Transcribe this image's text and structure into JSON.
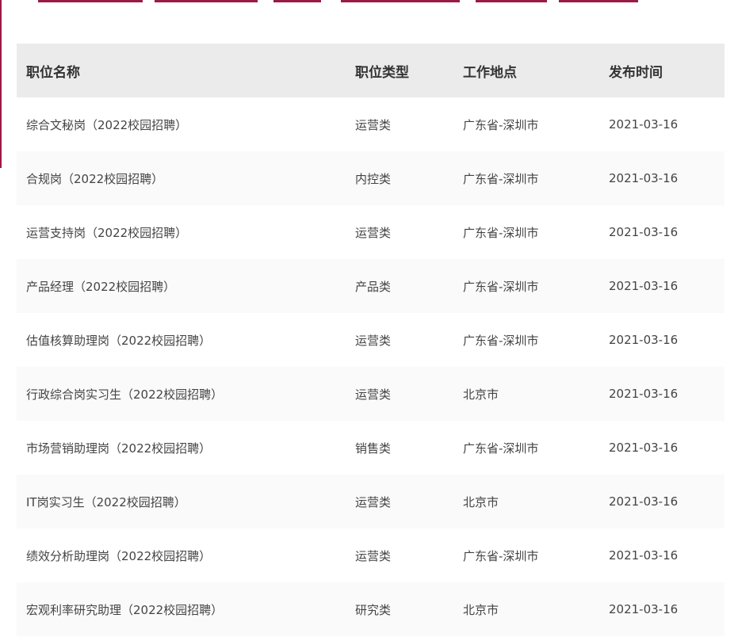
{
  "colors": {
    "accent": "#9a1b47",
    "header_bg": "#ebebeb",
    "row_alt_bg": "#fafafa"
  },
  "table": {
    "headers": {
      "name": "职位名称",
      "type": "职位类型",
      "location": "工作地点",
      "date": "发布时间"
    },
    "rows": [
      {
        "name": "综合文秘岗（2022校园招聘）",
        "type": "运营类",
        "location": "广东省-深圳市",
        "date": "2021-03-16"
      },
      {
        "name": "合规岗（2022校园招聘）",
        "type": "内控类",
        "location": "广东省-深圳市",
        "date": "2021-03-16"
      },
      {
        "name": "运营支持岗（2022校园招聘）",
        "type": "运营类",
        "location": "广东省-深圳市",
        "date": "2021-03-16"
      },
      {
        "name": "产品经理（2022校园招聘）",
        "type": "产品类",
        "location": "广东省-深圳市",
        "date": "2021-03-16"
      },
      {
        "name": "估值核算助理岗（2022校园招聘）",
        "type": "运营类",
        "location": "广东省-深圳市",
        "date": "2021-03-16"
      },
      {
        "name": "行政综合岗实习生（2022校园招聘）",
        "type": "运营类",
        "location": "北京市",
        "date": "2021-03-16"
      },
      {
        "name": "市场营销助理岗（2022校园招聘）",
        "type": "销售类",
        "location": "广东省-深圳市",
        "date": "2021-03-16"
      },
      {
        "name": "IT岗实习生（2022校园招聘）",
        "type": "运营类",
        "location": "北京市",
        "date": "2021-03-16"
      },
      {
        "name": "绩效分析助理岗（2022校园招聘）",
        "type": "运营类",
        "location": "广东省-深圳市",
        "date": "2021-03-16"
      },
      {
        "name": "宏观利率研究助理（2022校园招聘）",
        "type": "研究类",
        "location": "北京市",
        "date": "2021-03-16"
      }
    ]
  }
}
